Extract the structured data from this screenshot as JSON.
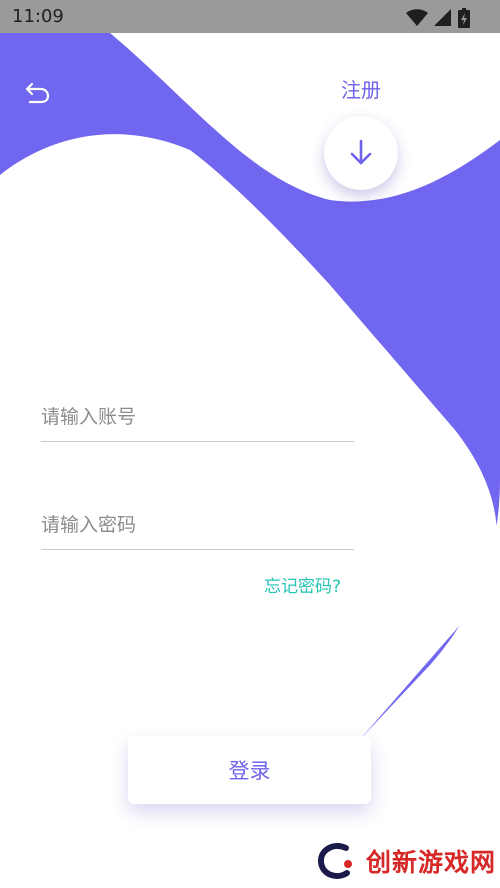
{
  "status_bar": {
    "time": "11:09",
    "icons": [
      "wifi-icon",
      "cell-signal-icon",
      "battery-icon"
    ]
  },
  "header": {
    "back_icon": "undo-arrow-icon",
    "register_label": "注册",
    "toggle_icon": "arrow-down-icon"
  },
  "form": {
    "account_placeholder": "请输入账号",
    "account_value": "",
    "password_placeholder": "请输入密码",
    "password_value": "",
    "forgot_label": "忘记密码?"
  },
  "actions": {
    "login_label": "登录"
  },
  "watermark": {
    "text": "创新游戏网"
  },
  "colors": {
    "accent": "#7166f0",
    "link_teal": "#25c4b3",
    "background": "#ffffff"
  }
}
